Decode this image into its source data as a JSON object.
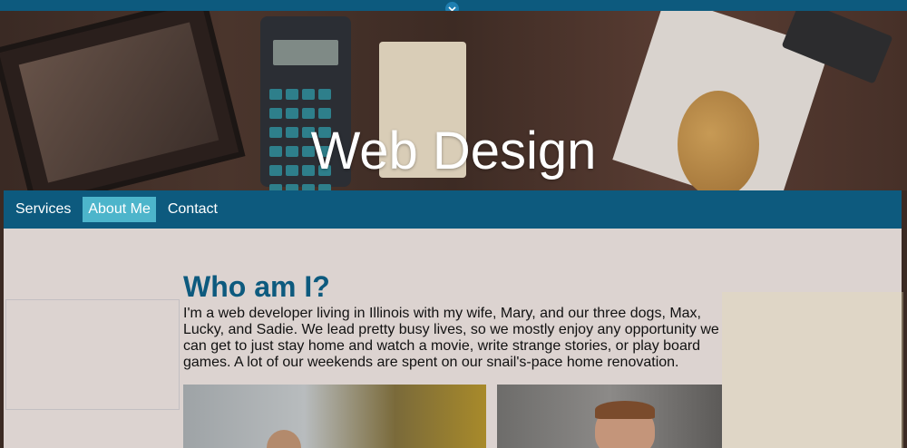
{
  "header": {
    "scroll_icon": "chevron-down-icon",
    "title": "Web Design"
  },
  "nav": {
    "items": [
      {
        "label": "Services",
        "active": false
      },
      {
        "label": "About Me",
        "active": true
      },
      {
        "label": "Contact",
        "active": false
      }
    ]
  },
  "main": {
    "heading": "Who am I?",
    "bio": "I'm a web developer living in Illinois with my wife, Mary, and our three dogs, Max, Lucky, and Sadie. We lead pretty busy lives, so we mostly enjoy any opportunity we can get to just stay home and watch a movie, write strange stories, or play board games. A lot of our weekends are spent on our snail's-pace home renovation."
  },
  "colors": {
    "brand": "#0d5a7e",
    "nav_active": "#4db5cb",
    "heading": "#0d5a7e"
  }
}
